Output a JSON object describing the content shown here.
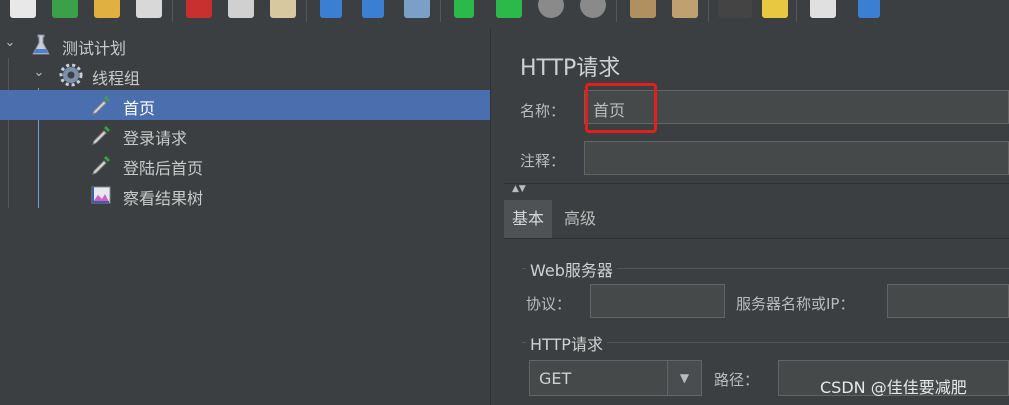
{
  "toolbar": {
    "icons": [
      "new-icon",
      "templates-icon",
      "open-icon",
      "save-icon",
      "cut-icon",
      "copy-icon",
      "paste-icon",
      "expand-icon",
      "collapse-icon",
      "toggle-icon",
      "start-icon",
      "start-no-pause-icon",
      "stop-icon",
      "shutdown-icon",
      "clear-icon",
      "clear-all-icon",
      "search-icon",
      "reset-search-icon",
      "function-helper-icon",
      "help-icon"
    ]
  },
  "tree": {
    "items": [
      {
        "label": "测试计划",
        "icon": "test-plan-icon"
      },
      {
        "label": "线程组",
        "icon": "thread-group-gear-icon"
      },
      {
        "label": "首页",
        "icon": "http-sampler-dropper-icon",
        "selected": true
      },
      {
        "label": "登录请求",
        "icon": "http-sampler-dropper-icon"
      },
      {
        "label": "登陆后首页",
        "icon": "http-sampler-dropper-icon"
      },
      {
        "label": "察看结果树",
        "icon": "view-results-tree-icon"
      }
    ]
  },
  "panel": {
    "title": "HTTP请求",
    "name_label": "名称：",
    "name_value": "首页",
    "comment_label": "注释：",
    "comment_value": "",
    "tabs": [
      "基本",
      "高级"
    ],
    "web_server": {
      "title": "Web服务器",
      "protocol_label": "协议：",
      "protocol_value": "",
      "server_label": "服务器名称或IP：",
      "server_value": ""
    },
    "http_request": {
      "title": "HTTP请求",
      "method": "GET",
      "path_label": "路径：",
      "path_value": ""
    }
  },
  "watermark": "CSDN @佳佳要减肥",
  "colors": {
    "background": "#3c3f41",
    "selection": "#4b6eaf",
    "highlight_box": "#e0201a"
  }
}
